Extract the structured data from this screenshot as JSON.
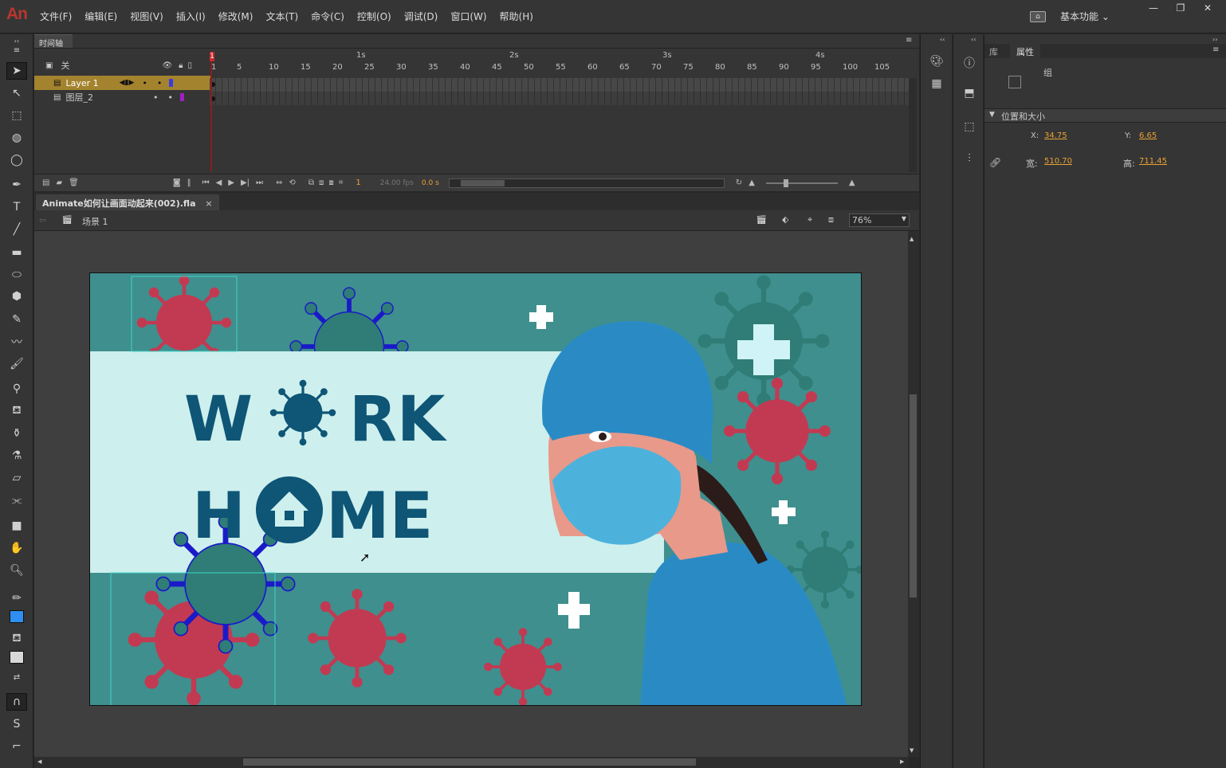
{
  "app": {
    "logo": "An"
  },
  "menu": [
    "文件(F)",
    "编辑(E)",
    "视图(V)",
    "插入(I)",
    "修改(M)",
    "文本(T)",
    "命令(C)",
    "控制(O)",
    "调试(D)",
    "窗口(W)",
    "帮助(H)"
  ],
  "workspace": {
    "label": "基本功能",
    "chevron": "⌄"
  },
  "window_controls": [
    "—",
    "❐",
    "✕"
  ],
  "timeline": {
    "tab": "时间轴",
    "header_label": "关",
    "layers": [
      {
        "name": "Layer 1",
        "selected": true,
        "color": "#3a3adf"
      },
      {
        "name": "图层_2",
        "selected": false,
        "color": "#a020c0"
      }
    ],
    "seconds": [
      "1s",
      "2s",
      "3s",
      "4s"
    ],
    "frame_ticks": [
      "1",
      "5",
      "10",
      "15",
      "20",
      "25",
      "30",
      "35",
      "40",
      "45",
      "50",
      "55",
      "60",
      "65",
      "70",
      "75",
      "80",
      "85",
      "90",
      "95",
      "100",
      "105"
    ],
    "current_frame": "1",
    "fps": "24.00 fps",
    "time": "0.0 s"
  },
  "document": {
    "tab": "Animate如何让画面动起来(002).fla",
    "close": "×",
    "scene": "场景 1",
    "zoom": "76%"
  },
  "artwork": {
    "line1_a": "W",
    "line1_b": "RK",
    "line2_a": "H",
    "line2_b": "ME"
  },
  "properties": {
    "tabs": [
      "库",
      "属性"
    ],
    "type": "组",
    "section": "位置和大小",
    "x_label": "X:",
    "x": "34.75",
    "y_label": "Y:",
    "y": "6.65",
    "w_label": "宽:",
    "w": "510.70",
    "h_label": "高:",
    "h": "711.45"
  },
  "colors": {
    "stage_bg": "#3f8f8e",
    "banner": "#cdefed",
    "text_blue": "#0e5576",
    "virus_red": "#c23a52",
    "mask_blue": "#4cb2dc",
    "cap_blue": "#2a8bc4",
    "accent_orange": "#e8a135"
  }
}
